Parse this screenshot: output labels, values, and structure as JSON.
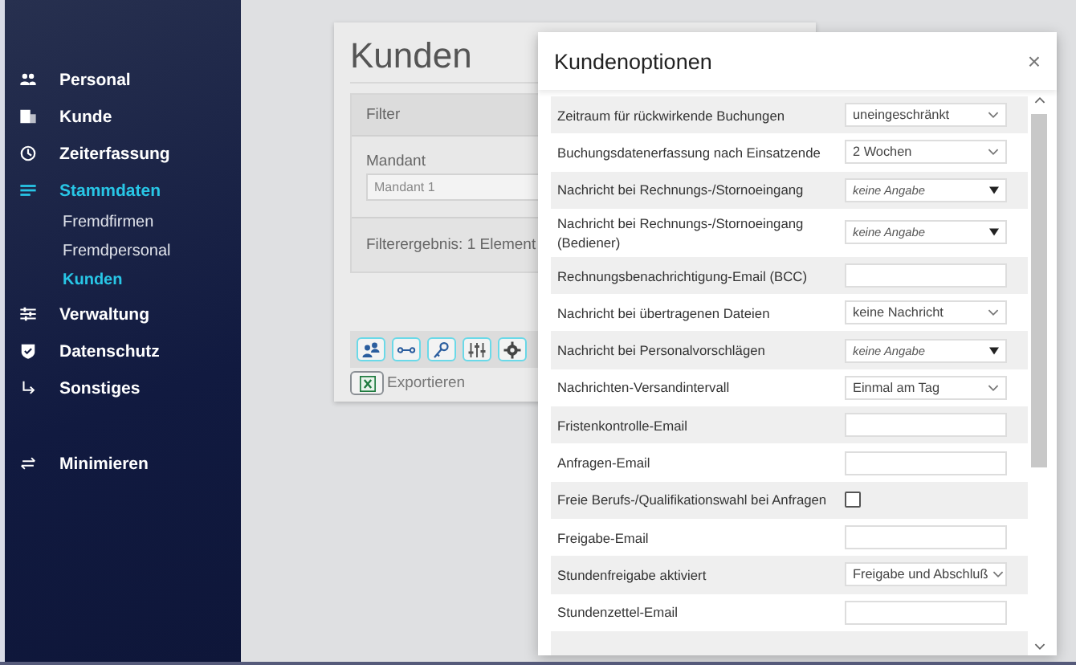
{
  "sidebar": {
    "items": [
      {
        "label": "Personal",
        "selected": false
      },
      {
        "label": "Kunde",
        "selected": false
      },
      {
        "label": "Zeiterfassung",
        "selected": false
      },
      {
        "label": "Stammdaten",
        "selected": true,
        "children": [
          {
            "label": "Fremdfirmen",
            "selected": false
          },
          {
            "label": "Fremdpersonal",
            "selected": false
          },
          {
            "label": "Kunden",
            "selected": true
          }
        ]
      },
      {
        "label": "Verwaltung",
        "selected": false
      },
      {
        "label": "Datenschutz",
        "selected": false
      },
      {
        "label": "Sonstiges",
        "selected": false
      }
    ],
    "minimize": {
      "label": "Minimieren"
    }
  },
  "page": {
    "title": "Kunden",
    "filter": {
      "title": "Filter",
      "field_label": "Mandant",
      "field_value": "Mandant 1",
      "result": "Filterergebnis: 1 Element"
    },
    "export": "Exportieren"
  },
  "dialog": {
    "title": "Kundenoptionen",
    "close": "×",
    "rows": [
      {
        "label": "Zeitraum für rückwirkende Buchungen",
        "kind": "select",
        "value": "uneingeschränkt"
      },
      {
        "label": "Buchungsdatenerfassung nach Einsatzende",
        "kind": "select",
        "value": "2 Wochen"
      },
      {
        "label": "Nachricht bei Rechnungs-/Stornoeingang",
        "kind": "dropdown",
        "value": "keine Angabe"
      },
      {
        "label": "Nachricht bei Rechnungs-/Stornoeingang (Bediener)",
        "kind": "dropdown",
        "value": "keine Angabe"
      },
      {
        "label": "Rechnungsbenachrichtigung-Email (BCC)",
        "kind": "input"
      },
      {
        "label": "Nachricht bei übertragenen Dateien",
        "kind": "select",
        "value": "keine Nachricht"
      },
      {
        "label": "Nachricht bei Personalvorschlägen",
        "kind": "dropdown",
        "value": "keine Angabe"
      },
      {
        "label": "Nachrichten-Versandintervall",
        "kind": "select",
        "value": "Einmal am Tag"
      },
      {
        "label": "Fristenkontrolle-Email",
        "kind": "input"
      },
      {
        "label": "Anfragen-Email",
        "kind": "input"
      },
      {
        "label": "Freie Berufs-/Qualifikationswahl bei Anfragen",
        "kind": "checkbox",
        "checked": false
      },
      {
        "label": "Freigabe-Email",
        "kind": "input"
      },
      {
        "label": "Stundenfreigabe aktiviert",
        "kind": "select",
        "value": "Freigabe und Abschluß"
      },
      {
        "label": "Stundenzettel-Email",
        "kind": "input"
      }
    ]
  }
}
